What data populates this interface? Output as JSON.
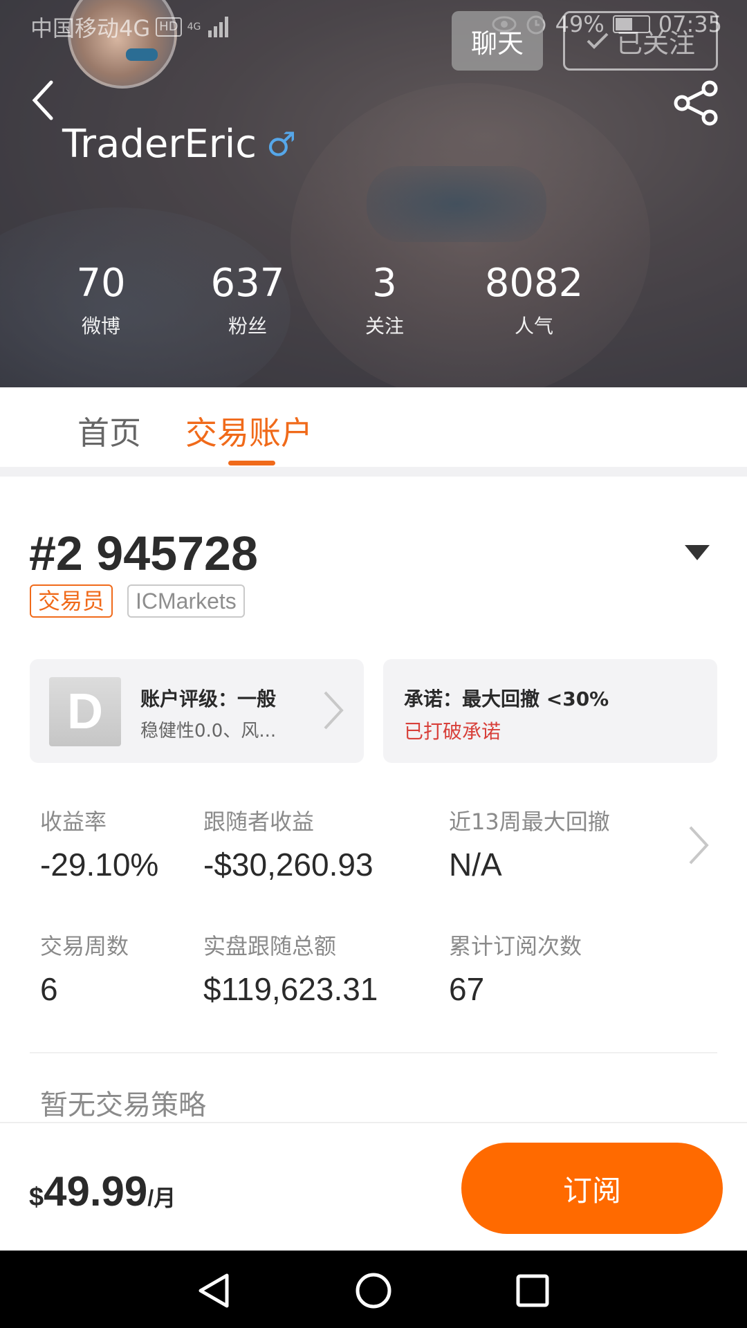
{
  "status_bar": {
    "carrier": "中国移动4G",
    "hd": "HD",
    "network": "4G",
    "battery": "49%",
    "time": "07:35"
  },
  "header": {
    "chat_label": "聊天",
    "follow_label": "已关注",
    "username": "TraderEric",
    "gender_symbol": "♂",
    "stats": [
      {
        "value": "70",
        "label": "微博"
      },
      {
        "value": "637",
        "label": "粉丝"
      },
      {
        "value": "3",
        "label": "关注"
      },
      {
        "value": "8082",
        "label": "人气"
      }
    ]
  },
  "tabs": [
    {
      "label": "首页",
      "active": false
    },
    {
      "label": "交易账户",
      "active": true
    }
  ],
  "account": {
    "number": "#2 945728",
    "tags": [
      "交易员",
      "ICMarkets"
    ],
    "rating": {
      "grade": "D",
      "title": "账户评级：一般",
      "subtitle": "稳健性0.0、风..."
    },
    "promise": {
      "title": "承诺：最大回撤 <30%",
      "status": "已打破承诺"
    },
    "metrics": [
      {
        "label": "收益率",
        "value": "-29.10%"
      },
      {
        "label": "跟随者收益",
        "value": "-$30,260.93"
      },
      {
        "label": "近13周最大回撤",
        "value": "N/A"
      },
      {
        "label": "交易周数",
        "value": "6"
      },
      {
        "label": "实盘跟随总额",
        "value": "$119,623.31"
      },
      {
        "label": "累计订阅次数",
        "value": "67"
      }
    ],
    "strategy_text": "暂无交易策略"
  },
  "subscribe": {
    "currency": "$",
    "amount": "49.99",
    "period": "/月",
    "button_label": "订阅"
  },
  "colors": {
    "accent": "#f06a1a",
    "button": "#ff6a00",
    "warning": "#d8403a",
    "gender": "#56a7e9"
  }
}
